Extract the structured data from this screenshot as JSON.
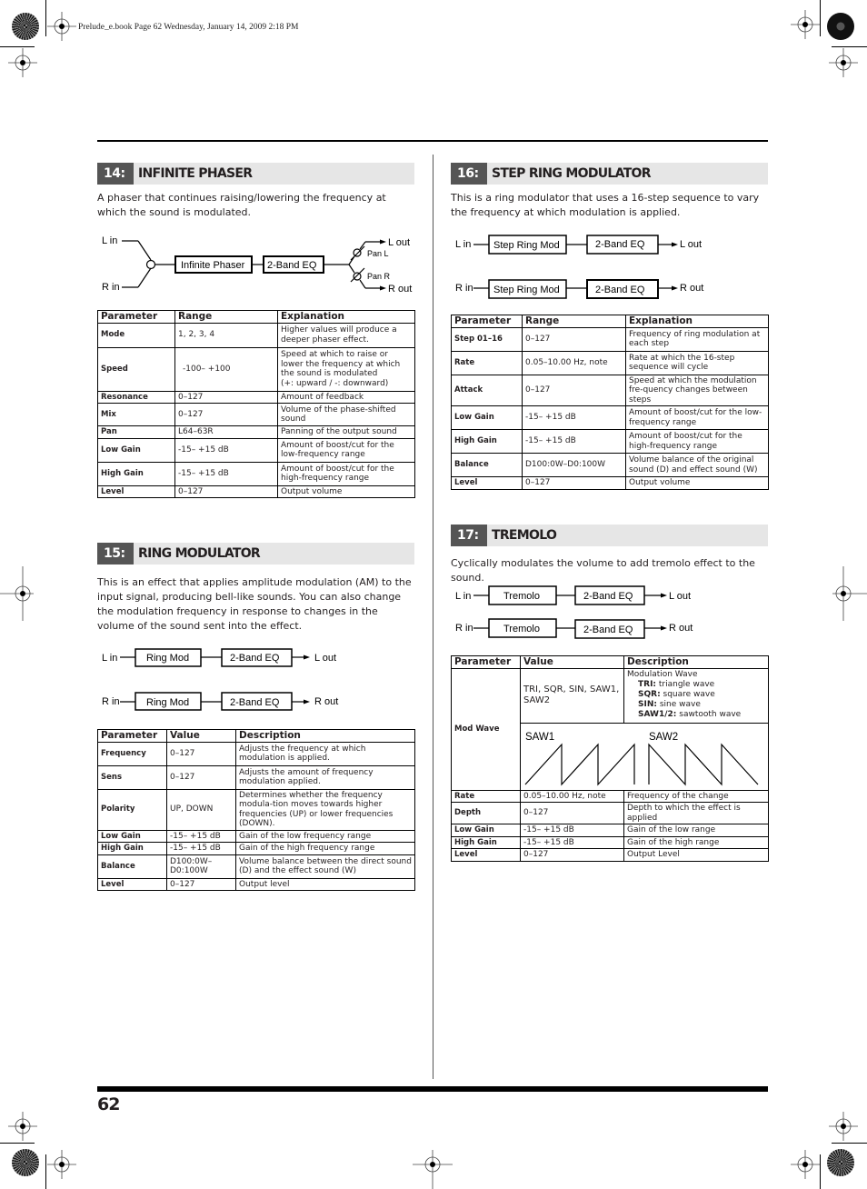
{
  "header": {
    "file_info": "Prelude_e.book  Page 62  Wednesday, January 14, 2009  2:18 PM"
  },
  "footer": {
    "page_number": "62"
  },
  "sections": {
    "s14": {
      "number": "14:",
      "title": "INFINITE PHASER",
      "description": "A phaser that continues raising/lowering the frequency at which the sound is modulated.",
      "diagram": {
        "l_in": "L in",
        "r_in": "R in",
        "block1": "Infinite Phaser",
        "block2": "2-Band EQ",
        "pan_l": "Pan L",
        "pan_r": "Pan R",
        "l_out": "L out",
        "r_out": "R out"
      },
      "table": {
        "headers": [
          "Parameter",
          "Range",
          "Explanation"
        ],
        "rows": [
          [
            "Mode",
            "1, 2, 3, 4",
            "Higher values will produce a deeper phaser effect."
          ],
          [
            "Speed",
            "-100– +100",
            "Speed at which to raise or lower the frequency at which the sound is modulated",
            " (+: upward / -: downward)"
          ],
          [
            "Resonance",
            "0–127",
            "Amount of feedback"
          ],
          [
            "Mix",
            "0–127",
            "Volume of the phase-shifted sound"
          ],
          [
            "Pan",
            "L64–63R",
            "Panning of the output sound"
          ],
          [
            "Low Gain",
            "-15– +15 dB",
            "Amount of boost/cut for the low-frequency range"
          ],
          [
            "High Gain",
            "-15– +15 dB",
            "Amount of boost/cut for the high-frequency range"
          ],
          [
            "Level",
            "0–127",
            "Output volume"
          ]
        ]
      }
    },
    "s15": {
      "number": "15:",
      "title": "RING MODULATOR",
      "description": "This is an effect that applies amplitude modulation (AM) to the input signal, producing bell-like sounds. You can also change the modulation frequency in response to changes in the volume of the sound sent into the effect.",
      "diagram": {
        "l_in": "L in",
        "r_in": "R in",
        "block1": "Ring Mod",
        "block2": "2-Band EQ",
        "l_out": "L out",
        "r_out": "R out"
      },
      "table": {
        "headers": [
          "Parameter",
          "Value",
          "Description"
        ],
        "rows": [
          [
            "Frequency",
            "0–127",
            "Adjusts the frequency at which modulation is applied."
          ],
          [
            "Sens",
            "0–127",
            "Adjusts the amount of frequency modulation applied."
          ],
          [
            "Polarity",
            "UP, DOWN",
            "Determines whether the frequency modula-tion moves towards higher frequencies (UP) or lower frequencies (DOWN)."
          ],
          [
            "Low Gain",
            "-15– +15 dB",
            "Gain of the low frequency range"
          ],
          [
            "High Gain",
            "-15– +15 dB",
            "Gain of the high frequency range"
          ],
          [
            "Balance",
            "D100:0W– D0:100W",
            "Volume balance between the direct sound (D) and the effect sound (W)"
          ],
          [
            "Level",
            "0–127",
            "Output level"
          ]
        ]
      }
    },
    "s16": {
      "number": "16:",
      "title": "STEP RING MODULATOR",
      "description": "This is a ring modulator that uses a 16-step sequence to vary the frequency at which modulation is applied.",
      "diagram": {
        "l_in": "L in",
        "r_in": "R in",
        "block1": "Step Ring Mod",
        "block2": "2-Band EQ",
        "l_out": "L out",
        "r_out": "R out"
      },
      "table": {
        "headers": [
          "Parameter",
          "Range",
          "Explanation"
        ],
        "rows": [
          [
            "Step 01–16",
            "0–127",
            "Frequency of ring modulation at each step"
          ],
          [
            "Rate",
            "0.05–10.00 Hz, note",
            "Rate at which the 16-step sequence will cycle"
          ],
          [
            "Attack",
            "0–127",
            "Speed at which the modulation fre-quency changes between steps"
          ],
          [
            "Low Gain",
            "-15– +15 dB",
            "Amount of boost/cut for the low-frequency range"
          ],
          [
            "High Gain",
            "-15– +15 dB",
            "Amount of boost/cut for the high-frequency range"
          ],
          [
            "Balance",
            "D100:0W–D0:100W",
            "Volume balance of the original sound (D) and effect sound (W)"
          ],
          [
            "Level",
            "0–127",
            "Output volume"
          ]
        ]
      }
    },
    "s17": {
      "number": "17:",
      "title": "TREMOLO",
      "description": "Cyclically modulates the volume to add tremolo effect to the sound.",
      "diagram": {
        "l_in": "L in",
        "r_in": "R in",
        "block1": "Tremolo",
        "block2": "2-Band EQ",
        "l_out": "L out",
        "r_out": "R out"
      },
      "table": {
        "headers": [
          "Parameter",
          "Value",
          "Description"
        ],
        "modwave": {
          "name": "Mod Wave",
          "value": "TRI, SQR, SIN, SAW1, SAW2",
          "desc_title": "Modulation Wave",
          "waves": [
            {
              "key": "TRI:",
              "text": " triangle wave"
            },
            {
              "key": "SQR:",
              "text": " square wave"
            },
            {
              "key": "SIN:",
              "text": " sine wave"
            },
            {
              "key": "SAW1/2:",
              "text": " sawtooth wave"
            }
          ],
          "saw1_label": "SAW1",
          "saw2_label": "SAW2"
        },
        "rows": [
          [
            "Rate",
            "0.05–10.00 Hz, note",
            "Frequency of the change"
          ],
          [
            "Depth",
            "0–127",
            "Depth to which the effect is applied"
          ],
          [
            "Low Gain",
            "-15– +15 dB",
            "Gain of the low range"
          ],
          [
            "High Gain",
            "-15– +15 dB",
            "Gain of the high range"
          ],
          [
            "Level",
            "0–127",
            "Output Level"
          ]
        ]
      }
    }
  }
}
